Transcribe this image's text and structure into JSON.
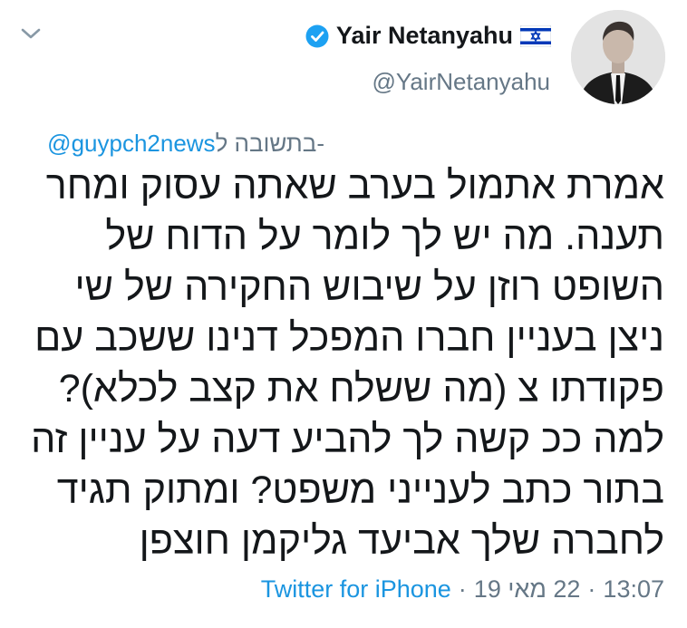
{
  "author": {
    "display_name": "Yair Netanyahu",
    "handle": "@YairNetanyahu"
  },
  "reply_context": {
    "prefix": "בתשובה ל-",
    "mention": "@guypch2news"
  },
  "tweet": {
    "lines": [
      "אמרת אתמול בערב שאתה עסוק ומחר",
      "תענה. מה יש לך לומר על הדוח של",
      "השופט רוזן על שיבוש החקירה של שי",
      "ניצן בעניין חברו המפכל דנינו ששכב עם",
      "פקודתו צ (מה ששלח את קצב לכלא)?",
      "למה ככ קשה לך להביע דעה על עניין זה",
      "בתור כתב לענייני משפט? ומתוק תגיד",
      "לחברה שלך אביעד גליקמן חוצפן"
    ]
  },
  "footer": {
    "time": "13:07",
    "date": "22 מאי 19",
    "separator": "·",
    "source": "Twitter for iPhone"
  },
  "icons": {
    "chevron": "chevron-down-icon",
    "verified": "verified-badge-icon",
    "flag": "israel-flag-icon"
  },
  "colors": {
    "link": "#1b95e0",
    "muted": "#657786",
    "text": "#14171a",
    "verified": "#1da1f2"
  }
}
